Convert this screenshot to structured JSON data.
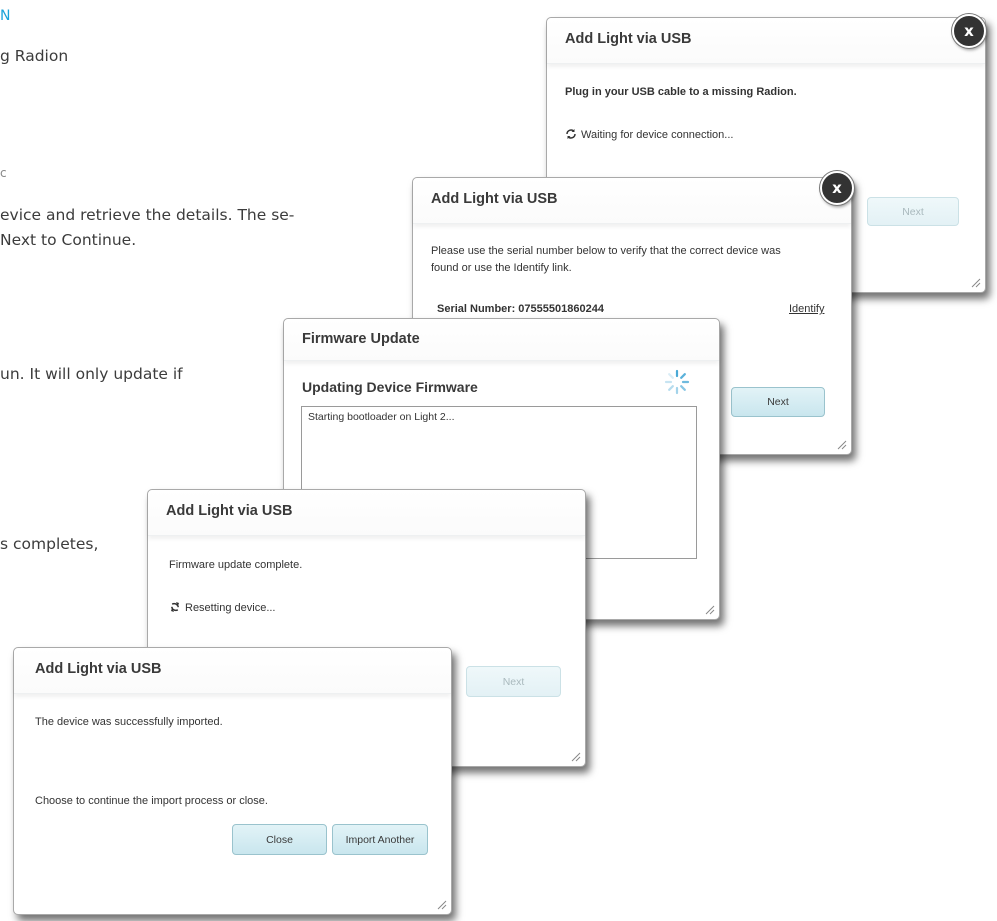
{
  "background": {
    "step_heading": "N",
    "line1": "g Radion",
    "line2": "c",
    "line3": "evice and retrieve the details. The se-",
    "line4": "Next to Continue.",
    "line5": "un. It will only update if",
    "line6": "s completes,"
  },
  "dialog1": {
    "title": "Add Light via USB",
    "instruction": "Plug in your USB cable to a missing Radion.",
    "status": "Waiting for device connection...",
    "next_label": "Next",
    "close_label": "x"
  },
  "dialog2": {
    "title": "Add Light via USB",
    "instruction_line1": "Please use the serial number below to verify that the correct device was",
    "instruction_line2": "found or use the Identify link.",
    "serial": "Serial Number: 07555501860244",
    "identify_label": "Identify",
    "next_label": "Next",
    "close_label": "x"
  },
  "dialog3": {
    "title": "Firmware Update",
    "subtitle": "Updating Device Firmware",
    "log": "Starting bootloader on Light 2..."
  },
  "dialog4": {
    "title": "Add Light via USB",
    "message": "Firmware update complete.",
    "status": "Resetting device...",
    "next_label": "Next"
  },
  "dialog5": {
    "title": "Add Light via USB",
    "message": "The device was successfully imported.",
    "prompt": "Choose to continue the import process or close.",
    "close_label": "Close",
    "import_another_label": "Import Another"
  },
  "colors": {
    "accent": "#1ba3d9",
    "button_fill": "#c9e6ee",
    "close_badge": "#333333"
  },
  "icons": [
    "refresh-icon",
    "close-icon",
    "loading-spinner-icon",
    "resize-grip-icon"
  ]
}
